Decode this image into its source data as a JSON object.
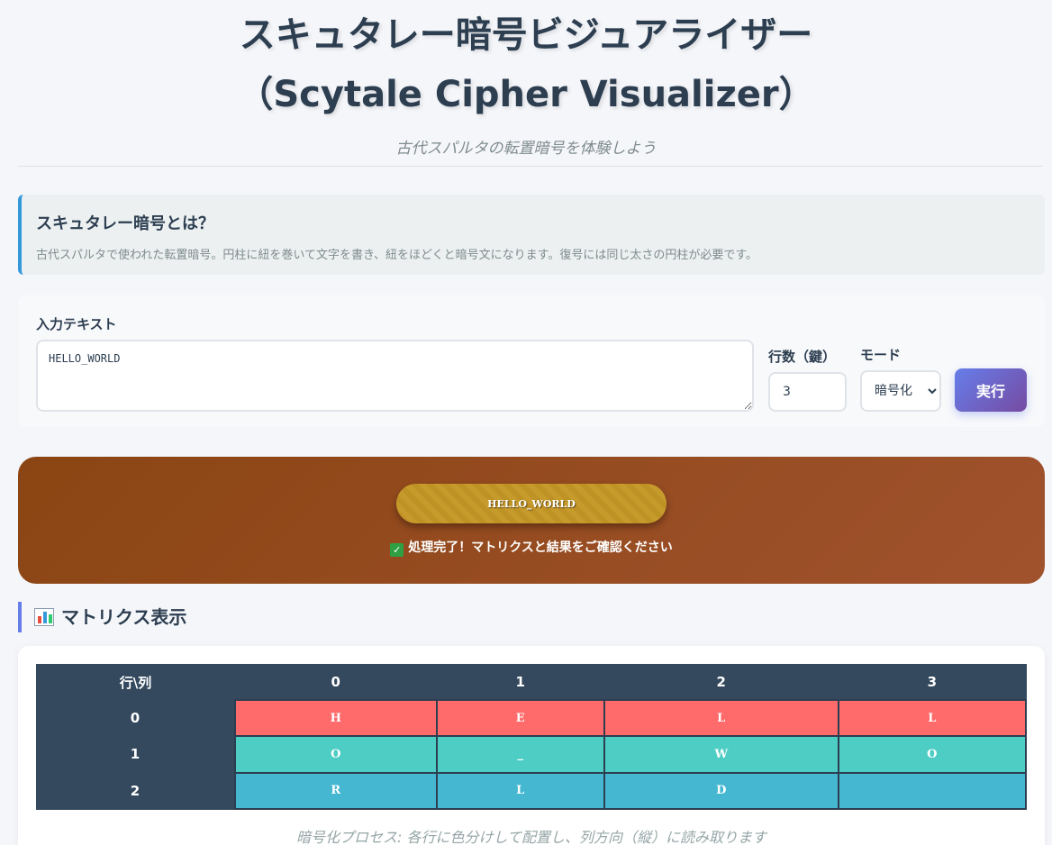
{
  "header": {
    "title_line1": "スキュタレー暗号ビジュアライザー",
    "title_line2": "（Scytale Cipher Visualizer）",
    "subtitle": "古代スパルタの転置暗号を体験しよう"
  },
  "info": {
    "title": "スキュタレー暗号とは？",
    "text": "古代スパルタで使われた転置暗号。円柱に紐を巻いて文字を書き、紐をほどくと暗号文になります。復号には同じ太さの円柱が必要です。"
  },
  "controls": {
    "input_label": "入力テキスト",
    "input_value": "HELLO_WORLD",
    "rows_label": "行数（鍵）",
    "rows_value": "3",
    "mode_label": "モード",
    "mode_selected": "暗号化",
    "execute_label": "実行"
  },
  "scroll": {
    "text": "HELLO_WORLD",
    "status": "処理完了！マトリクスと結果をご確認ください",
    "status_icon": "check-icon"
  },
  "matrix_section": {
    "title": "マトリクス表示",
    "icon": "bar-chart-icon",
    "corner_header": "行\\列",
    "col_headers": [
      "0",
      "1",
      "2",
      "3"
    ],
    "rows": [
      {
        "label": "0",
        "cells": [
          "H",
          "E",
          "L",
          "L"
        ],
        "color": "#ff6b6b"
      },
      {
        "label": "1",
        "cells": [
          "O",
          "_",
          "W",
          "O"
        ],
        "color": "#4ecdc4"
      },
      {
        "label": "2",
        "cells": [
          "R",
          "L",
          "D",
          ""
        ],
        "color": "#45b7d1"
      }
    ],
    "caption": "暗号化プロセス: 各行に色分けして配置し、列方向（縦）に読み取ります"
  },
  "colors": {
    "accent": "#667eea",
    "scroll_bg": "#8b4513",
    "header_bg": "#34495e"
  }
}
